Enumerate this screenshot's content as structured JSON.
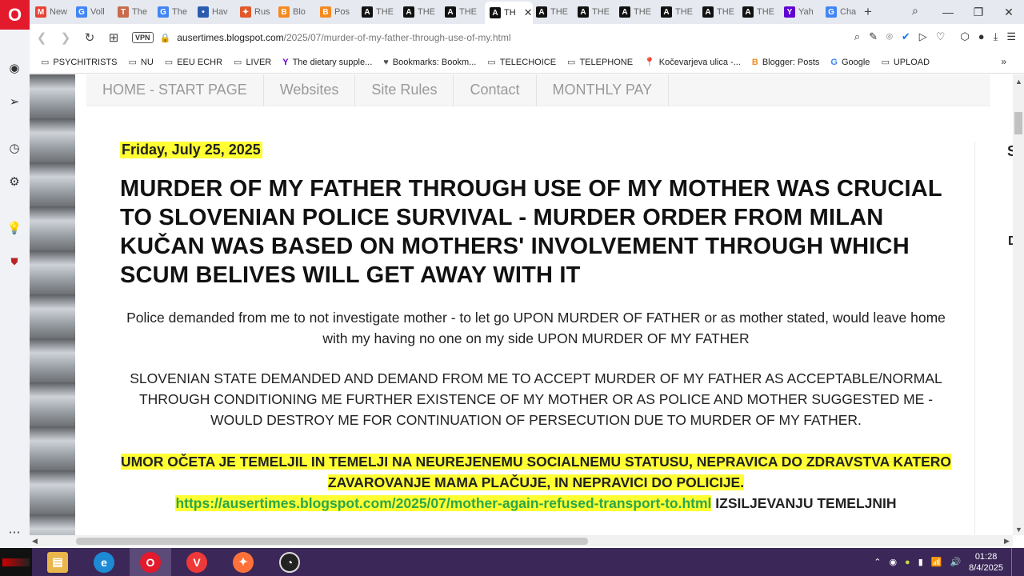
{
  "browser": {
    "tabs": [
      {
        "label": "New",
        "color": "#ea4335",
        "glyph": "M"
      },
      {
        "label": "Voll",
        "color": "#4285f4",
        "glyph": "G"
      },
      {
        "label": "The",
        "color": "#c96b4c",
        "glyph": "T"
      },
      {
        "label": "The",
        "color": "#4285f4",
        "glyph": "G"
      },
      {
        "label": "Hav",
        "color": "#2c5bb0",
        "glyph": "•"
      },
      {
        "label": "Rus",
        "color": "#e05a2b",
        "glyph": "✦"
      },
      {
        "label": "Blo",
        "color": "#f58a1f",
        "glyph": "B"
      },
      {
        "label": "Pos",
        "color": "#f58a1f",
        "glyph": "B"
      },
      {
        "label": "THE",
        "color": "#111111",
        "glyph": "A"
      },
      {
        "label": "THE",
        "color": "#111111",
        "glyph": "A"
      },
      {
        "label": "THE",
        "color": "#111111",
        "glyph": "A"
      },
      {
        "label": "TH",
        "color": "#111111",
        "glyph": "A",
        "active": true
      },
      {
        "label": "THE",
        "color": "#111111",
        "glyph": "A"
      },
      {
        "label": "THE",
        "color": "#111111",
        "glyph": "A"
      },
      {
        "label": "THE",
        "color": "#111111",
        "glyph": "A"
      },
      {
        "label": "THE",
        "color": "#111111",
        "glyph": "A"
      },
      {
        "label": "THE",
        "color": "#111111",
        "glyph": "A"
      },
      {
        "label": "THE",
        "color": "#111111",
        "glyph": "A"
      },
      {
        "label": "Yah",
        "color": "#6001d2",
        "glyph": "Y"
      },
      {
        "label": "Cha",
        "color": "#4285f4",
        "glyph": "G"
      }
    ],
    "new_tab": "+",
    "close_tab": "✕",
    "vpn_label": "VPN",
    "url_host": "ausertimes.blogspot.com",
    "url_path": "/2025/07/murder-of-my-father-through-use-of-my.html",
    "bookmarks": [
      {
        "label": "PSYCHITRISTS",
        "icon": "folder-icon"
      },
      {
        "label": "NU",
        "icon": "folder-icon"
      },
      {
        "label": "EEU ECHR",
        "icon": "folder-icon"
      },
      {
        "label": "LIVER",
        "icon": "folder-icon"
      },
      {
        "label": "The dietary supple...",
        "icon": "yahoo-icon"
      },
      {
        "label": "Bookmarks: Bookm...",
        "icon": "heart-icon"
      },
      {
        "label": "TELECHOICE",
        "icon": "folder-icon"
      },
      {
        "label": "TELEPHONE",
        "icon": "folder-icon"
      },
      {
        "label": "Kočevarjeva ulica -...",
        "icon": "map-pin-icon"
      },
      {
        "label": "Blogger: Posts",
        "icon": "blogger-icon"
      },
      {
        "label": "Google",
        "icon": "google-icon"
      },
      {
        "label": "UPLOAD",
        "icon": "folder-icon"
      }
    ]
  },
  "blog": {
    "nav": [
      "HOME - START PAGE",
      "Websites",
      "Site Rules",
      "Contact",
      "MONTHLY PAY"
    ],
    "date": "Friday, July 25, 2025",
    "title": "MURDER OF MY FATHER THROUGH USE OF MY MOTHER WAS CRUCIAL TO SLOVENIAN POLICE SURVIVAL - MURDER ORDER FROM MILAN KUČAN WAS BASED ON MOTHERS' INVOLVEMENT THROUGH WHICH SCUM BELIVES WILL GET AWAY WITH IT",
    "p1": "Police demanded from me to not investigate mother - to let go UPON MURDER OF FATHER or as mother stated, would leave home with my having no one on my side UPON MURDER OF MY FATHER",
    "p2": "SLOVENIAN STATE DEMANDED AND DEMAND FROM ME TO ACCEPT MURDER OF MY FATHER AS ACCEPTABLE/NORMAL THROUGH CONDITIONING ME FURTHER EXISTENCE OF MY MOTHER OR AS POLICE AND MOTHER SUGGESTED ME - WOULD DESTROY ME FOR CONTINUATION OF PERSECUTION DUE TO MURDER OF MY FATHER.",
    "p3_highlight": "UMOR OČETA JE TEMELJIL IN TEMELJI NA NEUREJENEMU SOCIALNEMU STATUSU, NEPRAVICA DO ZDRAVSTVA KATERO ZAVAROVANJE MAMA PLAČUJE, IN NEPRAVICI DO POLICIJE.",
    "p3_link": "https://ausertimes.blogspot.com/2025/07/mother-again-refused-transport-to.html",
    "p3_after": " IZSILJEVANJU TEMELJNIH",
    "right_s": "S",
    "right_d": "D"
  },
  "taskbar": {
    "time": "01:28",
    "date": "8/4/2025"
  },
  "colors": {
    "opera_red": "#e21a2c",
    "highlight": "#ffff33",
    "link_green": "#2ba64a",
    "taskbar": "#3b2758"
  }
}
